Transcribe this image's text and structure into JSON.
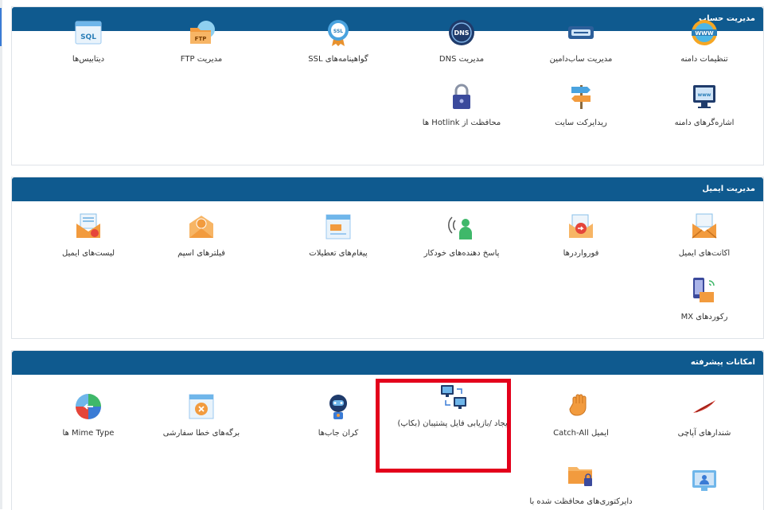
{
  "panels": [
    {
      "title": "مدیریت حساب",
      "items": [
        {
          "label": "تنظیمات دامنه",
          "icon": "www-globe-icon"
        },
        {
          "label": "مدیریت ساب‌دامین",
          "icon": "subdomain-icon"
        },
        {
          "label": "مدیریت DNS",
          "icon": "dns-icon"
        },
        {
          "label": "گواهینامه‌های SSL",
          "icon": "ssl-badge-icon"
        },
        {
          "label": "مدیریت FTP",
          "icon": "ftp-folder-icon",
          "badge": "FTP"
        },
        {
          "label": "دیتابیس‌ها",
          "icon": "sql-database-icon",
          "badge": "SQL"
        },
        {
          "label": "اشاره‌گرهای دامنه",
          "icon": "domain-pointer-icon",
          "badge": "www"
        },
        {
          "label": "ریدایرکت سایت",
          "icon": "signpost-icon"
        },
        {
          "label": "محافظت از Hotlink ها",
          "icon": "padlock-icon"
        }
      ]
    },
    {
      "title": "مدیریت ایمیل",
      "items": [
        {
          "label": "اکانت‌های ایمیل",
          "icon": "email-account-icon"
        },
        {
          "label": "فورواردرها",
          "icon": "forwarder-icon"
        },
        {
          "label": "پاسخ دهنده‌های خودکار",
          "icon": "autoresponder-icon"
        },
        {
          "label": "پیغام‌های تعطیلات",
          "icon": "vacation-message-icon"
        },
        {
          "label": "فیلترهای اسپم",
          "icon": "spam-filter-icon"
        },
        {
          "label": "لیست‌های ایمیل",
          "icon": "mailing-list-icon"
        },
        {
          "label": "رکوردهای MX",
          "icon": "mx-record-icon"
        }
      ]
    },
    {
      "title": "امکانات پیشرفته",
      "items": [
        {
          "label": "شندارهای آپاچی",
          "icon": "apache-feather-icon"
        },
        {
          "label": "ایمیل Catch-All",
          "icon": "catch-all-hand-icon"
        },
        {
          "label": "ایجاد /بازیابی فایل پشتیبان (بکاپ)",
          "icon": "backup-computers-icon"
        },
        {
          "label": "کران جاب‌ها",
          "icon": "cron-robot-icon"
        },
        {
          "label": "برگه‌های خطا سفارشی",
          "icon": "error-page-icon"
        },
        {
          "label": "Mime Type ها",
          "icon": "mime-type-icon"
        },
        {
          "label": "",
          "icon": "monitor-user-icon"
        },
        {
          "label": "دایرکتوری‌های محافظت شده با",
          "icon": "protected-folder-icon"
        }
      ]
    }
  ],
  "colors": {
    "header": "#0f5a8f",
    "highlight": "#e3001b"
  }
}
